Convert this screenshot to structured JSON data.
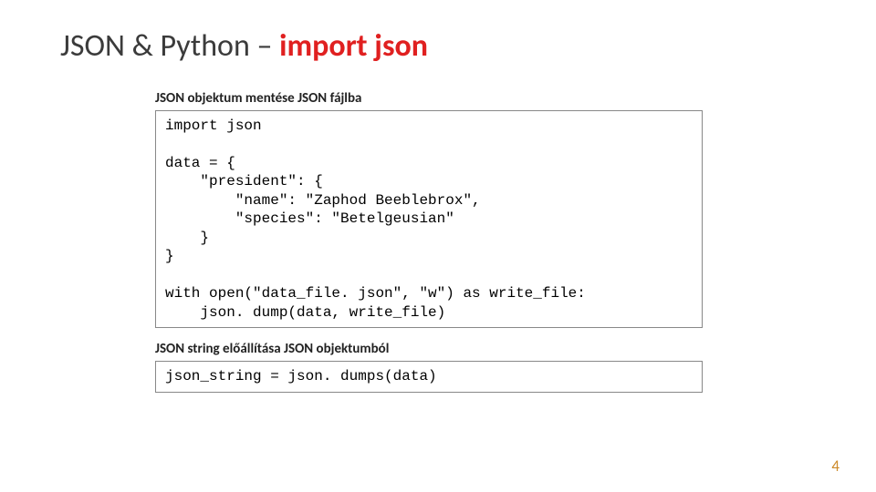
{
  "title": {
    "prefix": "JSON & Python – ",
    "highlight": "import json"
  },
  "sections": [
    {
      "label": "JSON objektum mentése JSON fájlba",
      "code": "import json\n\ndata = {\n    \"president\": {\n        \"name\": \"Zaphod Beeblebrox\",\n        \"species\": \"Betelgeusian\"\n    }\n}\n\nwith open(\"data_file. json\", \"w\") as write_file:\n    json. dump(data, write_file)"
    },
    {
      "label": "JSON string előállítása JSON objektumból",
      "code": "json_string = json. dumps(data)"
    }
  ],
  "page_number": "4"
}
